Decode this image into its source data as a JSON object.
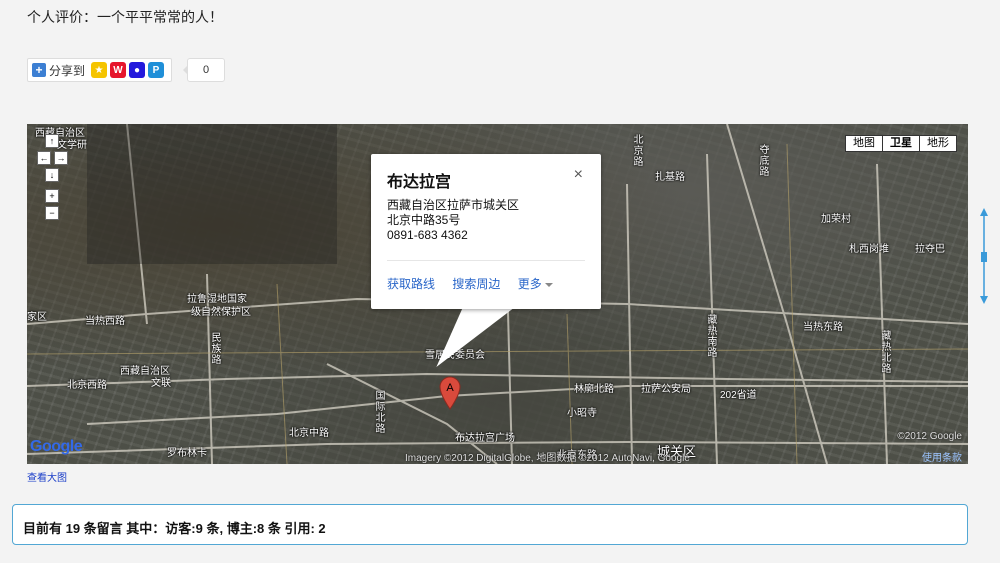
{
  "evaluation": "个人评价：一个平平常常的人！",
  "share": {
    "label": "分享到",
    "count": "0",
    "icons": [
      "qzone-icon",
      "weibo-icon",
      "baidu-icon",
      "renren-icon"
    ]
  },
  "map": {
    "types": [
      "地图",
      "卫星",
      "地形"
    ],
    "active_type": "卫星",
    "nav": {
      "up": "↑",
      "left": "←",
      "right": "→",
      "down": "↓",
      "zoom_in": "+",
      "zoom_out": "−"
    },
    "popup": {
      "title": "布达拉宫",
      "close": "×",
      "address_line1": "西藏自治区拉萨市城关区",
      "address_line2": "北京中路35号",
      "phone": "0891-683 4362",
      "link_route": "获取路线",
      "link_nearby": "搜索周边",
      "link_more": "更多"
    },
    "marker_label": "A",
    "labels": {
      "l1": "西藏自治区",
      "l2": "文学研",
      "l3": "拉鲁湿地国家",
      "l4": "级自然保护区",
      "l5": "当热西路",
      "l6": "西藏自治区",
      "l7": "文联",
      "l8": "北京西路",
      "l9": "民族路",
      "l10": "北京中路",
      "l11": "罗布林卡",
      "l12": "林廓北路",
      "l13": "拉萨公安局",
      "l14": "当热东路",
      "l15": "202省道",
      "l16": "小昭寺",
      "l17": "城关区",
      "l18": "北京东路",
      "l19": "加荣村",
      "l20": "札西岗堆",
      "l21": "拉夺巴",
      "l22": "夺底路",
      "l23": "雪居民委员会",
      "l24": "布达拉宫广场",
      "l25": "藏热北路",
      "l26": "北京路",
      "l27": "扎基路",
      "l28": "家区",
      "l29": "藏热南路",
      "l30": "国际北路"
    },
    "google": "Google",
    "copyright": "Imagery ©2012 DigitalGlobe, 地图数据 ©2012 AutoNavi, Google",
    "copyright2": "©2012 Google",
    "terms": "使用条款"
  },
  "bigmap_link": "查看大图",
  "message_summary": "目前有 19 条留言 其中：访客:9 条, 博主:8 条 引用: 2",
  "colors": {
    "link": "#2a66c9",
    "box_border": "#52a7d4",
    "marker": "#d94a3c"
  }
}
